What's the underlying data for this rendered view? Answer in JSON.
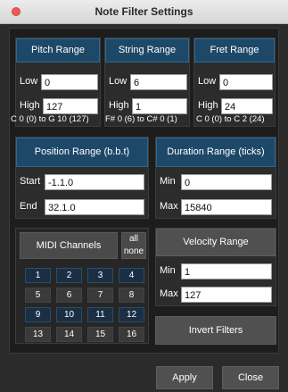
{
  "window": {
    "title": "Note Filter Settings"
  },
  "pitch": {
    "header": "Pitch Range",
    "low_label": "Low",
    "low_value": "0",
    "high_label": "High",
    "high_value": "127",
    "range_text": "C 0 (0) to G 10 (127)"
  },
  "string": {
    "header": "String Range",
    "low_label": "Low",
    "low_value": "6",
    "high_label": "High",
    "high_value": "1",
    "range_text": "F# 0 (6) to C# 0 (1)"
  },
  "fret": {
    "header": "Fret Range",
    "low_label": "Low",
    "low_value": "0",
    "high_label": "High",
    "high_value": "24",
    "range_text": "C 0 (0) to C 2 (24)"
  },
  "position": {
    "header": "Position Range (b.b.t)",
    "start_label": "Start",
    "start_value": "-1.1.0",
    "end_label": "End",
    "end_value": "32.1.0"
  },
  "duration": {
    "header": "Duration Range (ticks)",
    "min_label": "Min",
    "min_value": "0",
    "max_label": "Max",
    "max_value": "15840"
  },
  "midi": {
    "header": "MIDI Channels",
    "all_label": "all",
    "none_label": "none",
    "channels": [
      "1",
      "2",
      "3",
      "4",
      "5",
      "6",
      "7",
      "8",
      "9",
      "10",
      "11",
      "12",
      "13",
      "14",
      "15",
      "16"
    ]
  },
  "velocity": {
    "header": "Velocity Range",
    "min_label": "Min",
    "min_value": "1",
    "max_label": "Max",
    "max_value": "127"
  },
  "invert_label": "Invert Filters",
  "apply_label": "Apply",
  "close_label": "Close"
}
